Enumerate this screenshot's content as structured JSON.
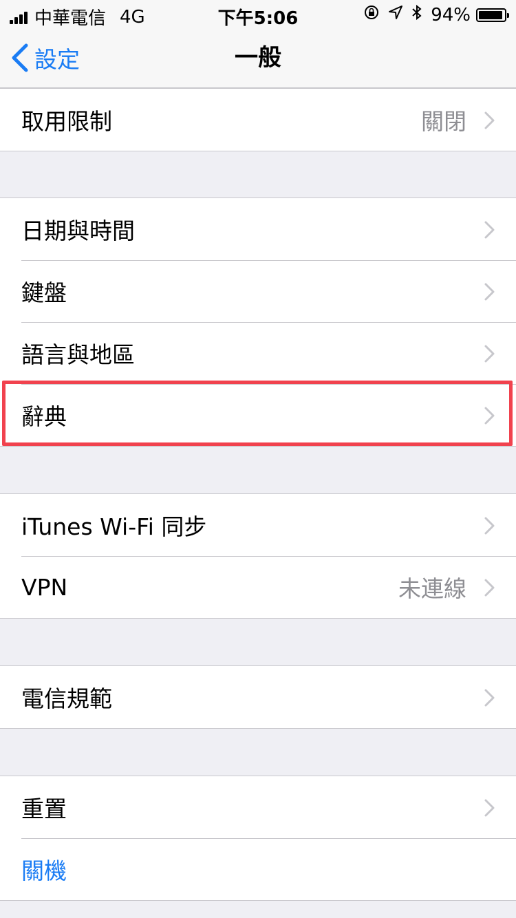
{
  "status_bar": {
    "carrier": "中華電信",
    "network": "4G",
    "time": "下午5:06",
    "battery_text": "94%",
    "battery_level": 0.94,
    "icons": [
      "orientation-lock-icon",
      "location-arrow-icon",
      "bluetooth-icon",
      "battery-icon"
    ]
  },
  "nav": {
    "back_label": "設定",
    "title": "一般"
  },
  "groups": [
    {
      "rows": [
        {
          "label": "取用限制",
          "value": "關閉"
        }
      ]
    },
    {
      "rows": [
        {
          "label": "日期與時間",
          "value": ""
        },
        {
          "label": "鍵盤",
          "value": ""
        },
        {
          "label": "語言與地區",
          "value": ""
        },
        {
          "label": "辭典",
          "value": ""
        }
      ]
    },
    {
      "rows": [
        {
          "label": "iTunes Wi-Fi 同步",
          "value": ""
        },
        {
          "label": "VPN",
          "value": "未連線"
        }
      ]
    },
    {
      "rows": [
        {
          "label": "電信規範",
          "value": ""
        }
      ]
    },
    {
      "rows": [
        {
          "label": "重置",
          "value": ""
        },
        {
          "label": "關機",
          "value": ""
        }
      ]
    }
  ],
  "colors": {
    "accent": "#1a7cf4",
    "highlight": "#f1424e",
    "background": "#efeff4"
  }
}
